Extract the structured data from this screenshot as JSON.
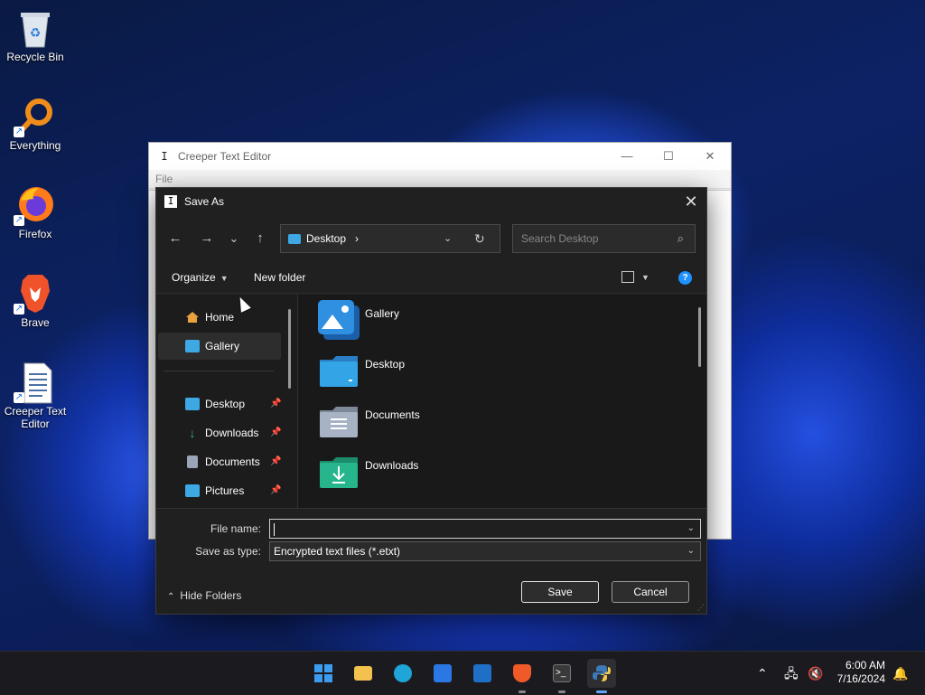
{
  "desktop": {
    "icons": [
      {
        "label": "Recycle Bin",
        "icon": "recycle-bin-icon"
      },
      {
        "label": "Everything",
        "icon": "everything-search-icon"
      },
      {
        "label": "Firefox",
        "icon": "firefox-icon"
      },
      {
        "label": "Brave",
        "icon": "brave-icon"
      },
      {
        "label": "Creeper Text\nEditor",
        "icon": "text-document-icon"
      }
    ]
  },
  "editor": {
    "title": "Creeper Text Editor",
    "menu": {
      "file": "File"
    },
    "window_controls": {
      "minimize": "—",
      "maximize": "☐",
      "close": "✕"
    }
  },
  "dialog": {
    "title": "Save As",
    "close_glyph": "✕",
    "nav": {
      "back": "←",
      "forward": "→",
      "recent": "⌄",
      "up": "↑"
    },
    "address": {
      "location": "Desktop",
      "separator": "›",
      "dropdown": "⌄",
      "refresh": "↻"
    },
    "search": {
      "placeholder": "Search Desktop",
      "icon_glyph": "⌕"
    },
    "toolbar": {
      "organize": "Organize",
      "new_folder": "New folder",
      "chevron": "▼",
      "help": "?"
    },
    "nav_pane": {
      "items": [
        {
          "label": "Home",
          "pinned": false,
          "selected": false,
          "color": "#e8a33d"
        },
        {
          "label": "Gallery",
          "pinned": false,
          "selected": true,
          "color": "#3ea8e5"
        },
        {
          "label": "Desktop",
          "pinned": true,
          "selected": false,
          "color": "#3ea8e5"
        },
        {
          "label": "Downloads",
          "pinned": true,
          "selected": false,
          "color": "#2fb58c"
        },
        {
          "label": "Documents",
          "pinned": true,
          "selected": false,
          "color": "#9aa6b8"
        },
        {
          "label": "Pictures",
          "pinned": true,
          "selected": false,
          "color": "#3ea8e5"
        }
      ],
      "pin_glyph": "📌"
    },
    "files": [
      {
        "label": "Gallery",
        "color": "#2f8fe0"
      },
      {
        "label": "Desktop",
        "color": "#33a4e6"
      },
      {
        "label": "Documents",
        "color": "#a7b3c4"
      },
      {
        "label": "Downloads",
        "color": "#26b58d"
      }
    ],
    "file_name": {
      "label": "File name:",
      "value": ""
    },
    "save_as_type": {
      "label": "Save as type:",
      "value": "Encrypted text files (*.etxt)"
    },
    "hide_folders": "Hide Folders",
    "hide_chevron": "⌃",
    "save_button": "Save",
    "cancel_button": "Cancel",
    "dropdown_glyph": "⌄"
  },
  "taskbar": {
    "apps": [
      {
        "name": "start",
        "color": "#3b9cf0",
        "active": false,
        "running": false
      },
      {
        "name": "file-explorer",
        "color": "#f2c14e",
        "active": false,
        "running": false
      },
      {
        "name": "edge",
        "color": "#1fa5d8",
        "active": false,
        "running": false
      },
      {
        "name": "store",
        "color": "#2b78e4",
        "active": false,
        "running": false
      },
      {
        "name": "outlook",
        "color": "#1f6fc6",
        "active": false,
        "running": false
      },
      {
        "name": "brave",
        "color": "#f05a28",
        "active": false,
        "running": true
      },
      {
        "name": "terminal",
        "color": "#3a3a3a",
        "active": false,
        "running": true
      },
      {
        "name": "python",
        "color": "#3d7ab8",
        "active": true,
        "running": true
      }
    ],
    "tray": {
      "chevron": "⌃",
      "network": "🖧",
      "volume": "🔇",
      "notifications": "🔔"
    },
    "time": "6:00 AM",
    "date": "7/16/2024"
  }
}
